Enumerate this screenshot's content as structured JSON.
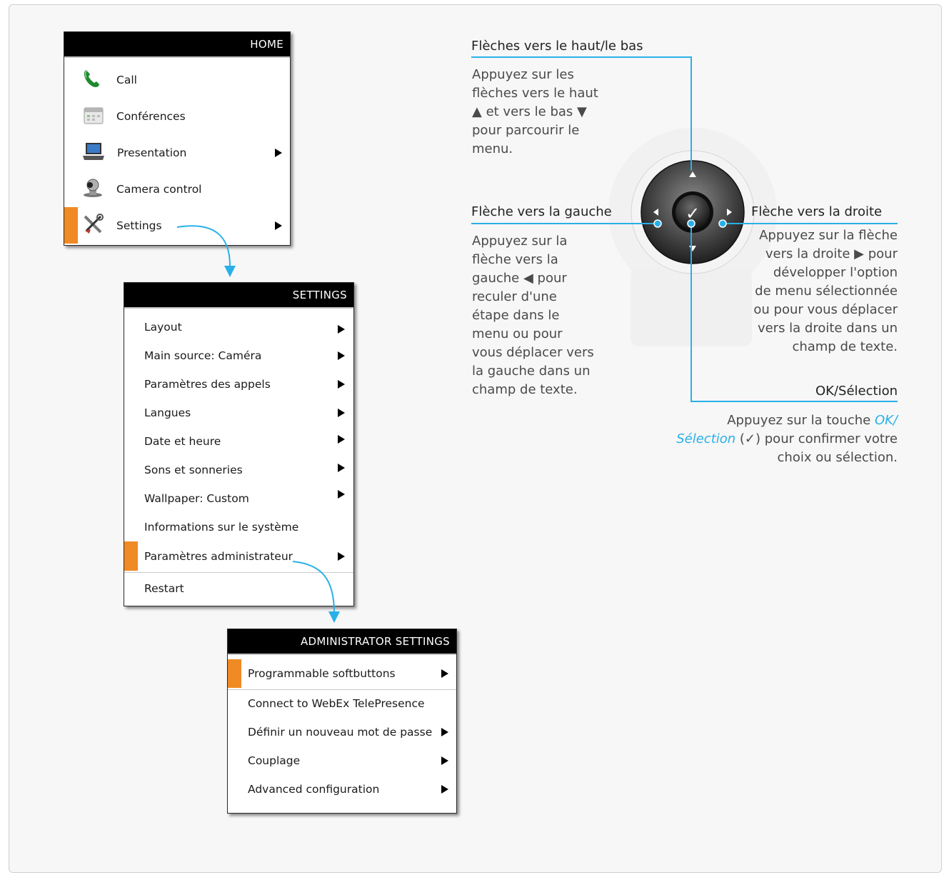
{
  "home_menu": {
    "title": "HOME",
    "items": [
      {
        "label": "Call",
        "icon": "phone-icon"
      },
      {
        "label": "Conférences",
        "icon": "calendar-icon"
      },
      {
        "label": "Presentation",
        "icon": "laptop-icon",
        "submenu": true
      },
      {
        "label": "Camera control",
        "icon": "camera-icon"
      },
      {
        "label": "Settings",
        "icon": "tools-icon",
        "submenu": true,
        "selected": true
      }
    ]
  },
  "settings_menu": {
    "title": "SETTINGS",
    "items": [
      {
        "label": "Layout",
        "submenu": true
      },
      {
        "label": "Main source: Caméra",
        "submenu": true
      },
      {
        "label": "Paramètres des appels",
        "submenu": true
      },
      {
        "label": "Langues",
        "submenu": true
      },
      {
        "label": "Date et heure",
        "submenu": true
      },
      {
        "label": "Sons et sonneries",
        "submenu": true
      },
      {
        "label": "Wallpaper: Custom",
        "submenu": true
      },
      {
        "label": "Informations sur le système",
        "submenu": false
      },
      {
        "label": "Paramètres administrateur",
        "submenu": true,
        "selected": true
      },
      {
        "label": "Restart",
        "submenu": false
      }
    ]
  },
  "admin_menu": {
    "title": "ADMINISTRATOR SETTINGS",
    "items": [
      {
        "label": "Programmable softbuttons",
        "submenu": true,
        "selected": true
      },
      {
        "label": "Connect to WebEx TelePresence",
        "submenu": false
      },
      {
        "label": "Définir un nouveau mot de passe",
        "submenu": true
      },
      {
        "label": "Couplage",
        "submenu": true
      },
      {
        "label": "Advanced configuration",
        "submenu": true
      }
    ]
  },
  "callouts": {
    "up_down": {
      "title": "Flèches vers le haut/le bas",
      "lines": [
        "Appuyez sur les",
        "flèches vers le haut",
        "▲ et vers le bas ▼",
        "pour parcourir le",
        "menu."
      ]
    },
    "left": {
      "title": "Flèche vers la gauche",
      "lines": [
        "Appuyez sur la",
        "flèche vers la",
        "gauche ◀ pour",
        "reculer d'une",
        "étape dans le",
        "menu ou pour",
        "vous déplacer vers",
        "la gauche dans un",
        "champ de texte."
      ]
    },
    "right": {
      "title": "Flèche vers la droite",
      "lines": [
        "Appuyez sur la flèche",
        "vers la droite ▶ pour",
        "développer l'option",
        "de menu sélectionnée",
        "ou pour vous déplacer",
        "vers la droite dans un",
        "champ de texte."
      ]
    },
    "ok": {
      "title": "OK/Sélection",
      "line1_prefix": "Appuyez sur la touche ",
      "line1_em": "OK/",
      "line2_em": "Sélection",
      "line2_suffix": " (✓) pour confirmer votre",
      "line3": "choix ou sélection."
    }
  },
  "remote": {
    "ok_symbol": "✓"
  },
  "colors": {
    "accent": "#29b0e8",
    "selection": "#f08a24",
    "header_bg": "#000000"
  }
}
